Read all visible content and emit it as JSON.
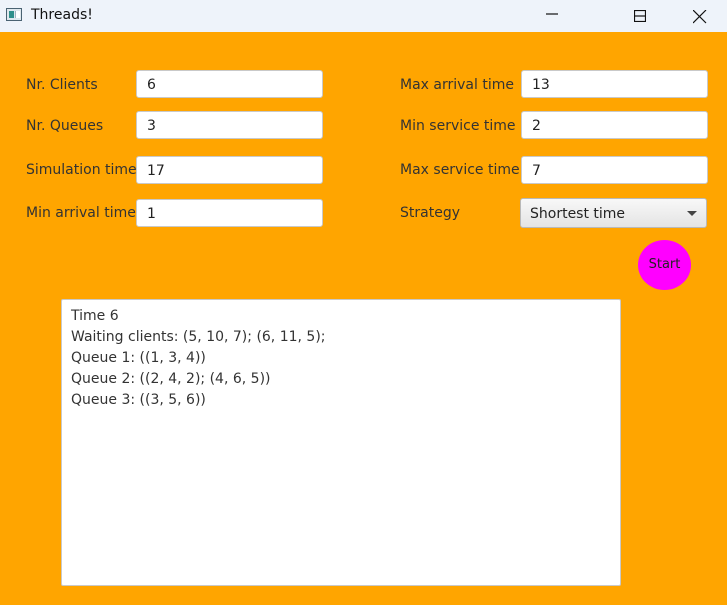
{
  "window": {
    "title": "Threads!",
    "icon": "app-window-icon",
    "controls": [
      "minimize-icon",
      "maximize-icon",
      "close-icon"
    ]
  },
  "form": {
    "nr_clients": {
      "label": "Nr. Clients",
      "value": "6"
    },
    "nr_queues": {
      "label": "Nr. Queues",
      "value": "3"
    },
    "simulation_time": {
      "label": "Simulation time",
      "value": "17"
    },
    "min_arrival_time": {
      "label": "Min arrival time",
      "value": "1"
    },
    "max_arrival_time": {
      "label": "Max arrival time",
      "value": "13"
    },
    "min_service_time": {
      "label": "Min service time",
      "value": "2"
    },
    "max_service_time": {
      "label": "Max service time",
      "value": "7"
    },
    "strategy": {
      "label": "Strategy",
      "selected": "Shortest time"
    }
  },
  "start_button": {
    "label": "Start",
    "color": "#ff00ff"
  },
  "log": {
    "lines": [
      "Time 6",
      "Waiting clients: (5, 10, 7); (6, 11, 5);",
      "Queue 1: ((1, 3, 4))",
      "Queue 2: ((2, 4, 2); (4, 6, 5))",
      "Queue 3: ((3, 5, 6))"
    ]
  },
  "colors": {
    "background": "#ffa500",
    "titlebar": "#eef3fa"
  }
}
